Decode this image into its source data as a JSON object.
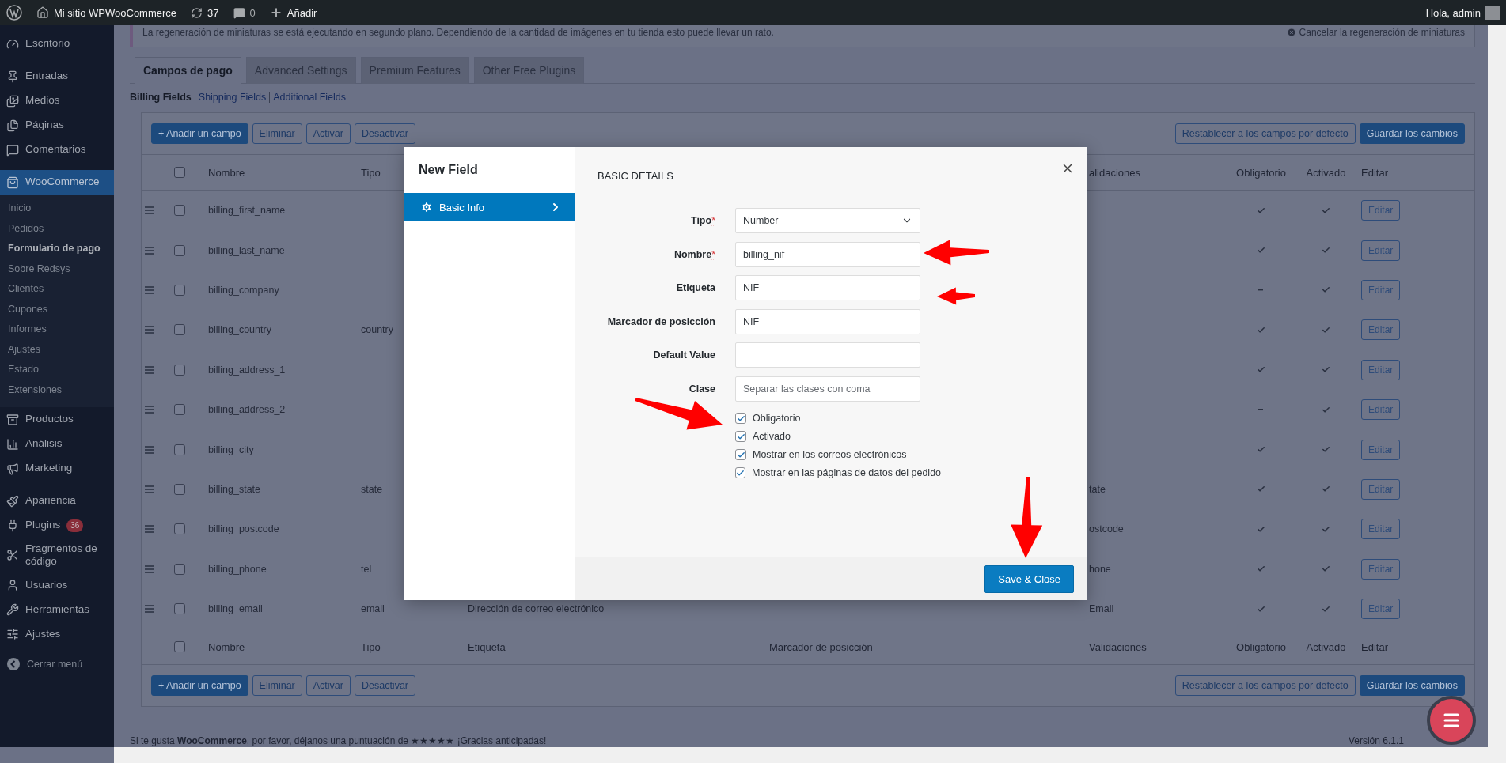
{
  "admin_bar": {
    "site": "Mi sitio WPWooCommerce",
    "updates": "37",
    "comments": "0",
    "new": "Añadir",
    "greeting": "Hola, admin"
  },
  "sidebar": {
    "groups": [
      [
        {
          "label": "Escritorio",
          "selected": false
        }
      ],
      [
        {
          "label": "Entradas",
          "selected": false
        },
        {
          "label": "Medios",
          "selected": false
        },
        {
          "label": "Páginas",
          "selected": false
        },
        {
          "label": "Comentarios",
          "selected": false
        }
      ],
      [
        {
          "label": "WooCommerce",
          "selected": true,
          "children": [
            {
              "label": "Inicio",
              "selected": false
            },
            {
              "label": "Pedidos",
              "selected": false
            },
            {
              "label": "Formulario de pago",
              "selected": true
            },
            {
              "label": "Sobre Redsys",
              "selected": false
            },
            {
              "label": "Clientes",
              "selected": false
            },
            {
              "label": "Cupones",
              "selected": false
            },
            {
              "label": "Informes",
              "selected": false
            },
            {
              "label": "Ajustes",
              "selected": false
            },
            {
              "label": "Estado",
              "selected": false
            },
            {
              "label": "Extensiones",
              "selected": false
            }
          ]
        },
        {
          "label": "Productos",
          "selected": false
        },
        {
          "label": "Análisis",
          "selected": false
        },
        {
          "label": "Marketing",
          "selected": false
        }
      ],
      [
        {
          "label": "Apariencia",
          "selected": false
        },
        {
          "label": "Plugins",
          "selected": false,
          "badge": "36"
        },
        {
          "label": "Fragmentos de código",
          "selected": false
        },
        {
          "label": "Usuarios",
          "selected": false
        },
        {
          "label": "Herramientas",
          "selected": false
        },
        {
          "label": "Ajustes",
          "selected": false
        }
      ]
    ],
    "collapse": "Cerrar menú"
  },
  "notice": {
    "text": "La regeneración de miniaturas se está ejecutando en segundo plano. Dependiendo de la cantidad de imágenes en tu tienda esto puede llevar un rato.",
    "cancel": "Cancelar la regeneración de miniaturas"
  },
  "tabs": [
    {
      "label": "Campos de pago",
      "selected": true
    },
    {
      "label": "Advanced Settings",
      "selected": false
    },
    {
      "label": "Premium Features",
      "selected": false
    },
    {
      "label": "Other Free Plugins",
      "selected": false
    }
  ],
  "sections": [
    {
      "label": "Billing Fields",
      "selected": true
    },
    {
      "label": "Shipping Fields",
      "selected": false
    },
    {
      "label": "Additional Fields",
      "selected": false
    }
  ],
  "table": {
    "top_actions": {
      "left": [
        {
          "label": "+ Añadir un campo",
          "primary": true
        },
        {
          "label": "Eliminar",
          "primary": false
        },
        {
          "label": "Activar",
          "primary": false
        },
        {
          "label": "Desactivar",
          "primary": false
        }
      ],
      "right": [
        {
          "label": "Restablecer a los campos por defecto",
          "primary": false
        },
        {
          "label": "Guardar los cambios",
          "primary": true
        }
      ]
    },
    "header_top": {
      "checked": false,
      "nombre": "Nombre",
      "tipo": "Tipo",
      "validaciones": "alidaciones",
      "obligatorio": "Obligatorio",
      "activado": "Activado",
      "editar": "Editar"
    },
    "rows": [
      {
        "checked": false,
        "name": "billing_first_name",
        "required": true,
        "enabled": true,
        "edit": "Editar"
      },
      {
        "checked": false,
        "name": "billing_last_name",
        "required": true,
        "enabled": true,
        "edit": "Editar"
      },
      {
        "checked": false,
        "name": "billing_company",
        "required": false,
        "enabled": true,
        "edit": "Editar"
      },
      {
        "checked": false,
        "name": "billing_country",
        "type": "country",
        "required": true,
        "enabled": true,
        "edit": "Editar"
      },
      {
        "checked": false,
        "name": "billing_address_1",
        "required": true,
        "enabled": true,
        "edit": "Editar"
      },
      {
        "checked": false,
        "name": "billing_address_2",
        "required": false,
        "enabled": true,
        "edit": "Editar"
      },
      {
        "checked": false,
        "name": "billing_city",
        "required": true,
        "enabled": true,
        "edit": "Editar"
      },
      {
        "checked": false,
        "name": "billing_state",
        "type": "state",
        "validation": "tate",
        "required": true,
        "enabled": true,
        "edit": "Editar"
      },
      {
        "checked": false,
        "name": "billing_postcode",
        "validation": "ostcode",
        "required": true,
        "enabled": true,
        "edit": "Editar"
      },
      {
        "checked": false,
        "name": "billing_phone",
        "type": "tel",
        "validation": "hone",
        "required": true,
        "enabled": true,
        "edit": "Editar"
      },
      {
        "checked": false,
        "name": "billing_email",
        "type": "email",
        "label": "Dirección de correo electrónico",
        "validation": "Email",
        "required": true,
        "enabled": true,
        "edit": "Editar"
      }
    ],
    "header_bottom": {
      "checked": false,
      "nombre": "Nombre",
      "tipo": "Tipo",
      "etiqueta": "Etiqueta",
      "marcador": "Marcador de posicción",
      "validaciones": "Validaciones",
      "obligatorio": "Obligatorio",
      "activado": "Activado",
      "editar": "Editar"
    },
    "bottom_actions": {
      "left": [
        {
          "label": "+ Añadir un campo",
          "primary": true
        },
        {
          "label": "Eliminar",
          "primary": false
        },
        {
          "label": "Activar",
          "primary": false
        },
        {
          "label": "Desactivar",
          "primary": false
        }
      ],
      "right": [
        {
          "label": "Restablecer a los campos por defecto",
          "primary": false
        },
        {
          "label": "Guardar los cambios",
          "primary": true
        }
      ]
    }
  },
  "footer": {
    "text": "Si te gusta **WooCommerce**, por favor, déjanos una puntuación de ★★★★★ ¡Gracias anticipadas!",
    "version": "Versión 6.1.1"
  },
  "modal": {
    "title": "New Field",
    "nav": [
      {
        "label": "Basic Info",
        "selected": true
      }
    ],
    "section": "BASIC DETAILS",
    "fields": [
      {
        "kind": "select",
        "label": "Tipo",
        "required_mark": "*",
        "value": "Number"
      },
      {
        "kind": "text",
        "label": "Nombre",
        "required_mark": "*",
        "value": "billing_nif"
      },
      {
        "kind": "text",
        "label": "Etiqueta",
        "value": "NIF"
      },
      {
        "kind": "text",
        "label": "Marcador de posicción",
        "value": "NIF"
      },
      {
        "kind": "text",
        "label": "Default Value"
      },
      {
        "kind": "text",
        "label": "Clase",
        "placeholder": "Separar las clases con coma"
      }
    ],
    "options": [
      {
        "label": "Obligatorio",
        "checked": true
      },
      {
        "label": "Activado",
        "checked": true
      },
      {
        "label": "Mostrar en los correos electrónicos",
        "checked": true
      },
      {
        "label": "Mostrar en las páginas de datos del pedido",
        "checked": true
      }
    ],
    "save": "Save & Close"
  }
}
